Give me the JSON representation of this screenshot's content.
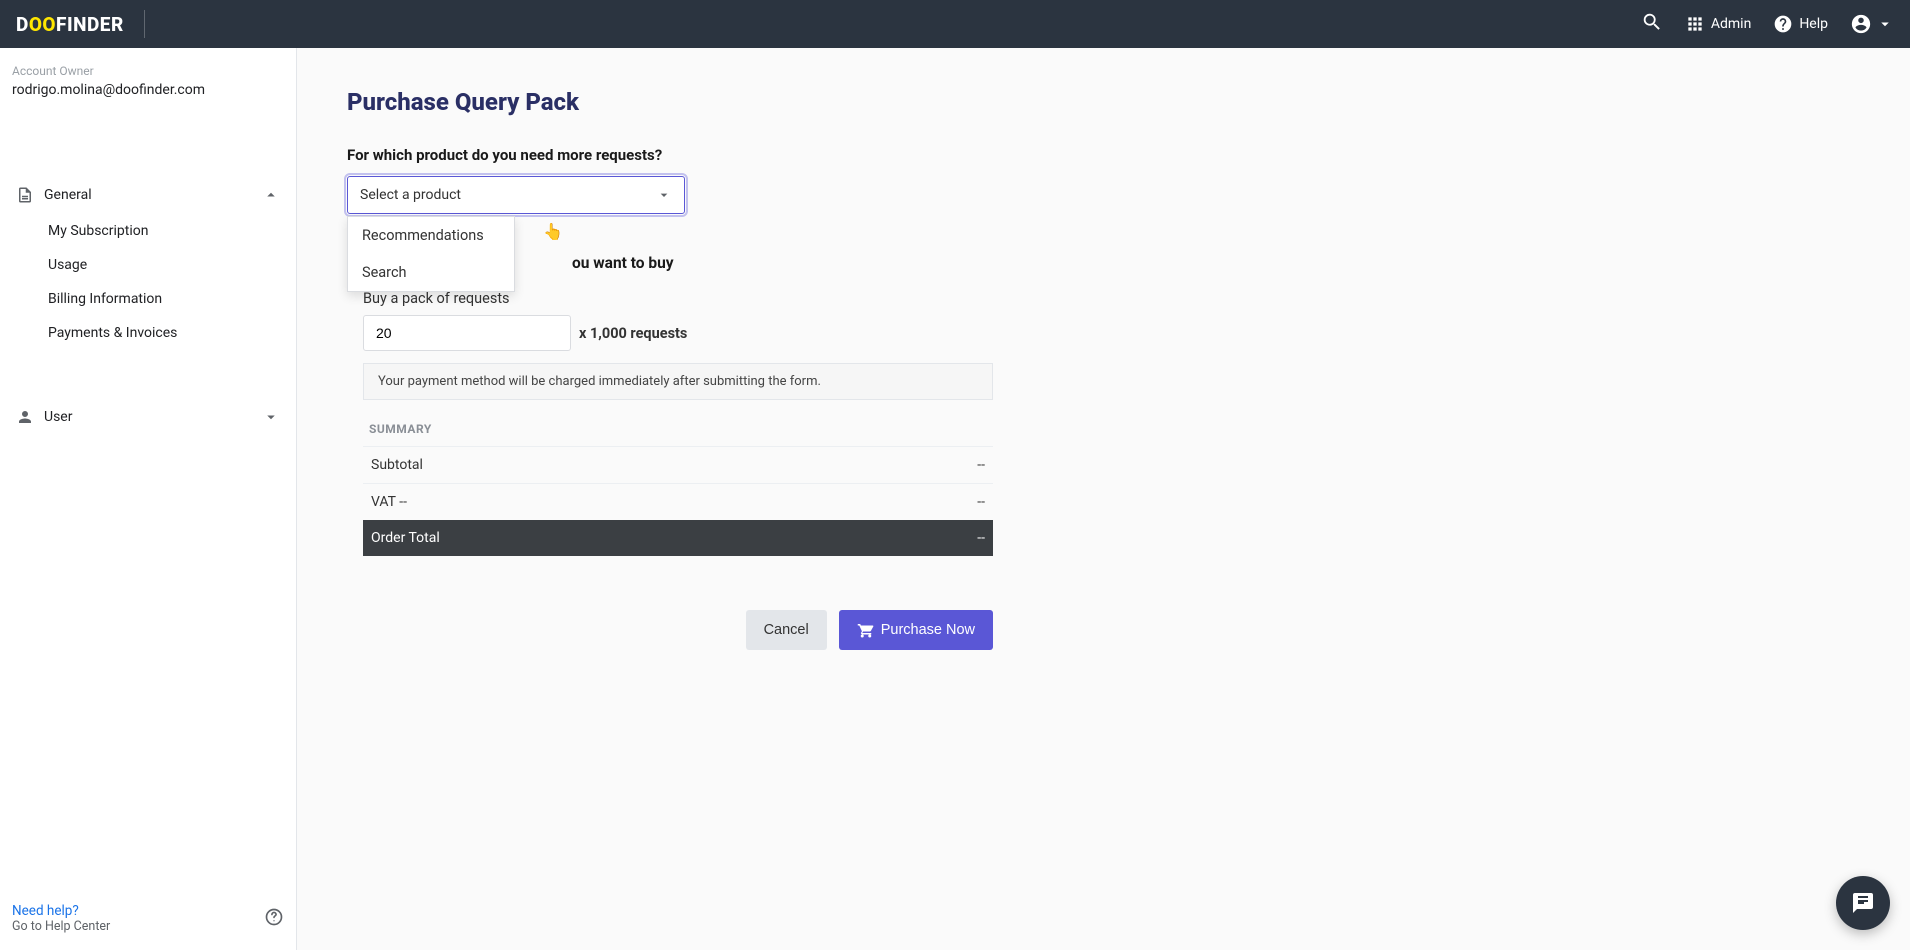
{
  "brand": {
    "pre": "D",
    "oo": "OO",
    "post": "FINDER"
  },
  "topbar": {
    "admin": "Admin",
    "help": "Help"
  },
  "sidebar": {
    "account_owner_label": "Account Owner",
    "account_owner_email": "rodrigo.molina@doofinder.com",
    "general": {
      "label": "General",
      "children": {
        "my_subscription": "My Subscription",
        "usage": "Usage",
        "billing_info": "Billing Information",
        "payments_invoices": "Payments & Invoices"
      }
    },
    "user": {
      "label": "User"
    },
    "footer": {
      "need_help_title": "Need help?",
      "need_help_sub": "Go to Help Center"
    }
  },
  "main": {
    "page_title": "Purchase Query Pack",
    "product_question": "For which product do you need more requests?",
    "select_placeholder": "Select a product",
    "dropdown_options": {
      "recommendations": "Recommendations",
      "search": "Search"
    },
    "how_many_label": "ou want to buy",
    "pack_label": "Buy a pack of requests",
    "qty_value": "20",
    "qty_suffix": "x 1,000 requests",
    "info_text": "Your payment method will be charged immediately after submitting the form.",
    "summary_title": "SUMMARY",
    "summary": {
      "subtotal_label": "Subtotal",
      "subtotal_value": "--",
      "vat_label": "VAT --",
      "vat_value": "--",
      "total_label": "Order Total",
      "total_value": "--"
    },
    "actions": {
      "cancel": "Cancel",
      "purchase": "Purchase Now"
    }
  }
}
